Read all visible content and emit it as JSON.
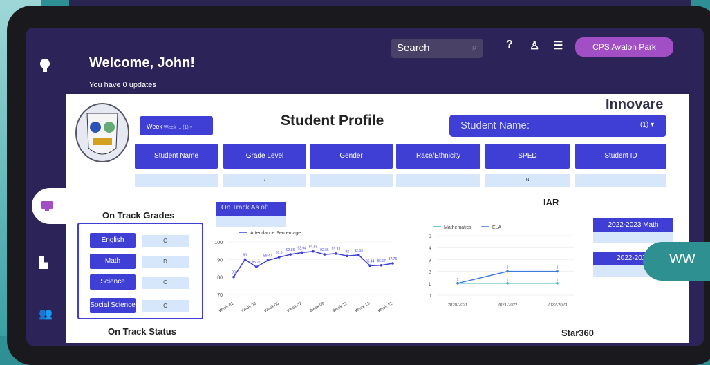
{
  "header": {
    "welcome": "Welcome, John!",
    "updates": "You have 0 updates",
    "search_placeholder": "Search",
    "school_button": "CPS Avalon Park"
  },
  "profile": {
    "title": "Student Profile",
    "brand": "Innovare",
    "week_label": "Week",
    "week_value": "Week ... (1)",
    "student_name_label": "Student Name:",
    "student_name_value": "(1)",
    "columns": [
      {
        "label": "Student Name",
        "value": ""
      },
      {
        "label": "Grade Level",
        "value": "7"
      },
      {
        "label": "Gender",
        "value": ""
      },
      {
        "label": "Race/Ethnicity",
        "value": ""
      },
      {
        "label": "SPED",
        "value": "N"
      },
      {
        "label": "Student ID",
        "value": ""
      }
    ]
  },
  "on_track_grades": {
    "title": "On Track Grades",
    "rows": [
      {
        "subject": "English",
        "grade": "C"
      },
      {
        "subject": "Math",
        "grade": "D"
      },
      {
        "subject": "Science",
        "grade": "C"
      },
      {
        "subject": "Social Science",
        "grade": "C"
      }
    ]
  },
  "on_track_as_of": "On Track As of:",
  "on_track_status": "On Track Status",
  "iar": {
    "title": "IAR",
    "buttons": [
      "2022-2023 Math",
      "2022-2023"
    ]
  },
  "star360": "Star360",
  "overlay_text": "WW",
  "colors": {
    "accent": "#3f3fd6",
    "brand_purple": "#a24fc6",
    "header_bg": "#2c2358"
  },
  "chart_data": [
    {
      "type": "line",
      "series": [
        {
          "name": "Attendance Percentage",
          "values": [
            80,
            90,
            85.71,
            89.47,
            91.3,
            92.86,
            93.94,
            94.59,
            92.86,
            93.33,
            92,
            92.59,
            86.44,
            86.67,
            87.76
          ]
        }
      ],
      "x": [
        "Week 01",
        "Week 02",
        "Week 03",
        "Week 04",
        "Week 05",
        "Week 06",
        "Week 07",
        "Week 08",
        "Week 09",
        "Week 10",
        "Week 11",
        "Week 12",
        "Week 13",
        "Week 14",
        "Week 15"
      ],
      "x_tick_labels": [
        "Week 01",
        "Week 03",
        "Week 05",
        "Week 07",
        "Week 09",
        "Week 11",
        "Week 13",
        "Week 22"
      ],
      "y_ticks": [
        "70",
        "80",
        "90",
        "100"
      ],
      "ylim": [
        70,
        100
      ]
    },
    {
      "type": "line",
      "categories": [
        "2020-2021",
        "2021-2022",
        "2022-2023"
      ],
      "series": [
        {
          "name": "Mathematics",
          "values": [
            1,
            1,
            1
          ]
        },
        {
          "name": "ELA",
          "values": [
            1,
            2,
            2
          ]
        }
      ],
      "y_ticks": [
        "0",
        "1",
        "2",
        "3",
        "4",
        "5"
      ],
      "ylim": [
        0,
        5
      ]
    }
  ]
}
